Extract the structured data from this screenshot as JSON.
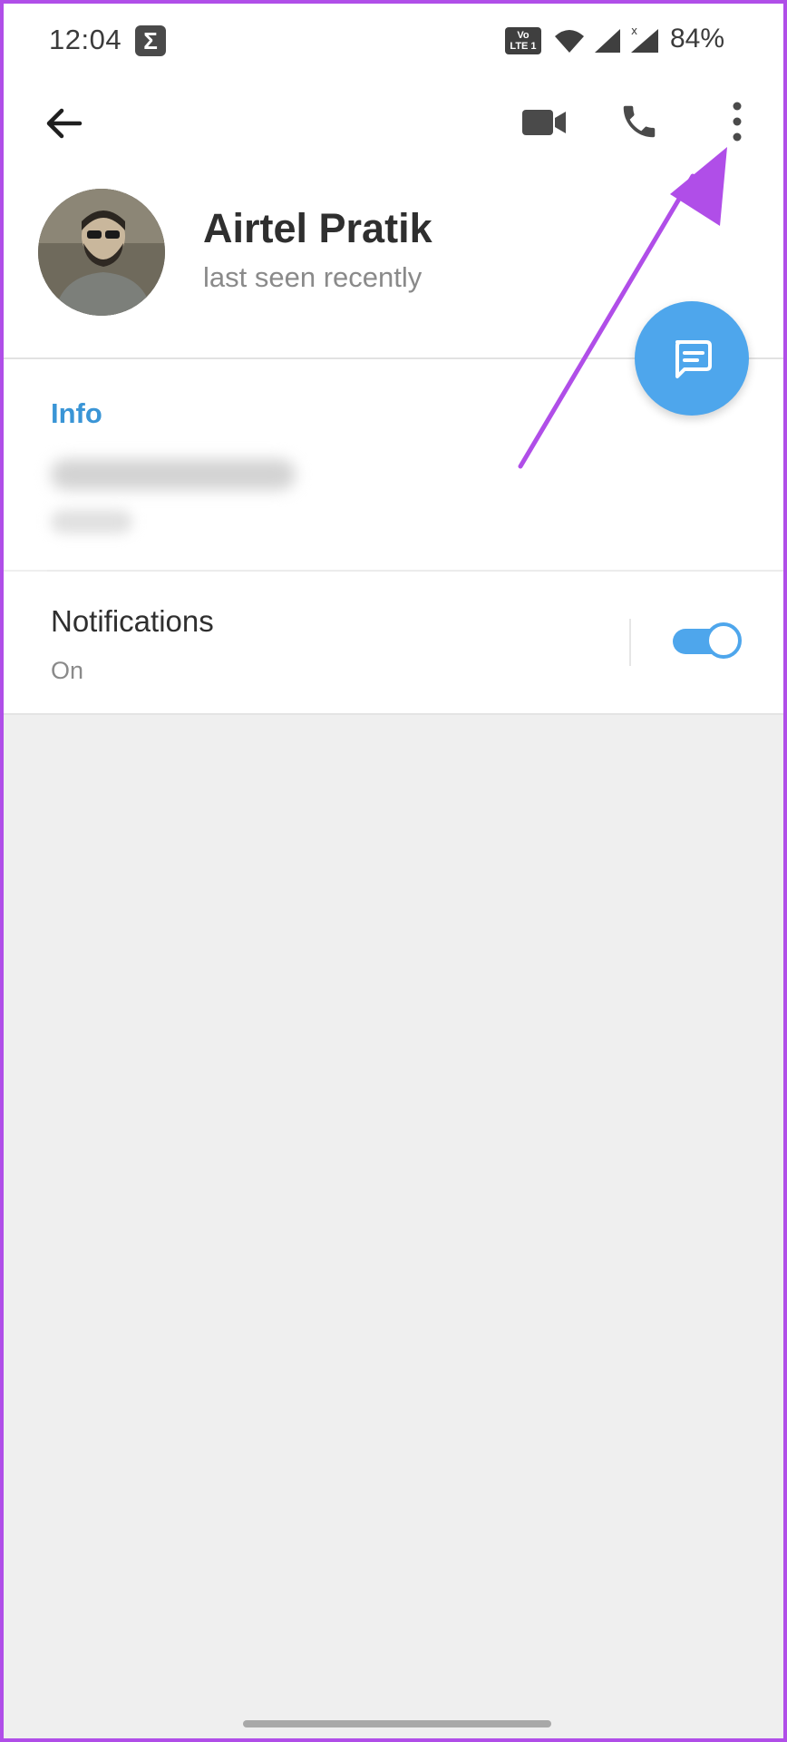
{
  "status_bar": {
    "time": "12:04",
    "notification_icon": "sigma-icon",
    "volte_label": "Vo LTE 1",
    "battery": "84%"
  },
  "header": {
    "back_icon": "arrow-left-icon",
    "video_call_icon": "video-camera-icon",
    "voice_call_icon": "phone-icon",
    "more_icon": "vertical-dots-icon"
  },
  "profile": {
    "name": "Airtel Pratik",
    "status": "last seen recently"
  },
  "fab": {
    "icon": "message-icon"
  },
  "info": {
    "heading": "Info"
  },
  "notifications": {
    "title": "Notifications",
    "state": "On",
    "enabled": true
  },
  "colors": {
    "accent": "#4ea6ec",
    "link": "#3a95d6",
    "annotation": "#b04ee8",
    "background": "#efefef"
  }
}
